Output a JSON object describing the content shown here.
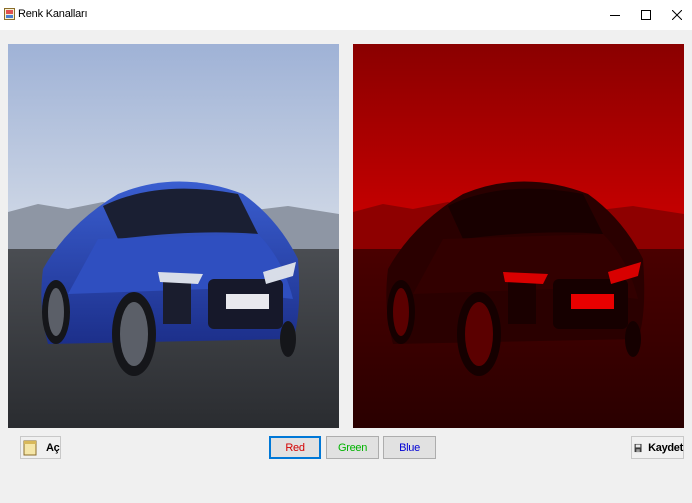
{
  "window": {
    "title": "Renk Kanalları",
    "app_icon": "app-icon",
    "controls": [
      "minimize-icon",
      "maximize-icon",
      "close-icon"
    ]
  },
  "images": {
    "left": {
      "name": "original-image",
      "icon": "car-photo"
    },
    "right": {
      "name": "red-channel-image",
      "icon": "car-photo-red"
    }
  },
  "buttons": {
    "open_label": "Aç",
    "red_label": "Red",
    "green_label": "Green",
    "blue_label": "Blue",
    "save_label": "Kaydet"
  },
  "colors": {
    "red": "#d40000",
    "green": "#00b400",
    "blue": "#0000d4",
    "focus": "#0078d7"
  }
}
